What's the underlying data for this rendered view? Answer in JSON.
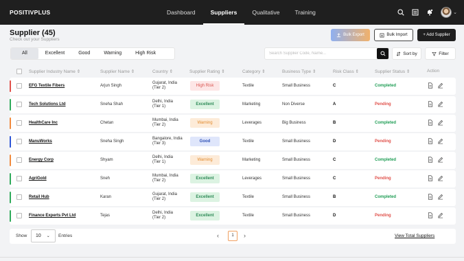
{
  "app": {
    "logo": "POSITIVPLUS",
    "nav": [
      {
        "label": "Dashboard",
        "active": false
      },
      {
        "label": "Suppliers",
        "active": true
      },
      {
        "label": "Qualitative",
        "active": false
      },
      {
        "label": "Training",
        "active": false
      }
    ],
    "icons": [
      "search-icon",
      "clipboard-icon",
      "notification-icon",
      "avatar",
      "chevron-down-icon"
    ]
  },
  "header": {
    "title": "Supplier (45)",
    "subtitle": "Check out  your Suppliers",
    "bulk_export": "Bulk Export",
    "bulk_import": "Bulk Import",
    "add_supplier": "+ Add Supplier"
  },
  "filters": {
    "tabs": [
      "All",
      "Excellent",
      "Good",
      "Warning",
      "High Risk"
    ],
    "active_tab": "All",
    "search_placeholder": "Search Supplier Code, Name...",
    "sort_label": "Sort by",
    "filter_label": "Filter"
  },
  "table": {
    "columns": [
      "Supplier Industry Name",
      "Supplier Name",
      "Country",
      "Supplier Rating",
      "Category",
      "Business Type",
      "Risk Class",
      "Supplier Status",
      "Action"
    ],
    "rows": [
      {
        "industry": "EFG Textile Fibers",
        "name": "Arjun Singh",
        "country": [
          "Gujarat, India",
          "(Tier 2)"
        ],
        "rating": "High Risk",
        "category": "Textile",
        "business": "Small Business",
        "risk": "C",
        "status": "Completed",
        "color": "#e0504a"
      },
      {
        "industry": "Tech Solutions Ltd",
        "name": "Sneha Shah",
        "country": [
          "Delhi, India",
          "(Tier 1)"
        ],
        "rating": "Excellent",
        "category": "Marketing",
        "business": "Non Diverse",
        "risk": "A",
        "status": "Pending",
        "color": "#2eaa5a"
      },
      {
        "industry": "HealthCare Inc",
        "name": "Chetan",
        "country": [
          "Mumbai, India",
          "(Tier 2)"
        ],
        "rating": "Warning",
        "category": "Leverages",
        "business": "Big Business",
        "risk": "B",
        "status": "Completed",
        "color": "#f08a3c"
      },
      {
        "industry": "ManuWorks",
        "name": "Sneha Singh",
        "country": [
          "Bangalore, India",
          "(Tier 3)"
        ],
        "rating": "Good",
        "category": "Textile",
        "business": "Small Business",
        "risk": "D",
        "status": "Pending",
        "color": "#2d56d6"
      },
      {
        "industry": "Energy Corp",
        "name": "Shyam",
        "country": [
          "Delhi, India",
          "(Tier 1)"
        ],
        "rating": "Warning",
        "category": "Marketing",
        "business": "Small Business",
        "risk": "C",
        "status": "Completed",
        "color": "#f08a3c"
      },
      {
        "industry": "AgriGold",
        "name": "Sneh",
        "country": [
          "Mumbai, India",
          "(Tier 2)"
        ],
        "rating": "Excellent",
        "category": "Leverages",
        "business": "Small Business",
        "risk": "C",
        "status": "Pending",
        "color": "#2eaa5a"
      },
      {
        "industry": "Retail Hub",
        "name": "Karan",
        "country": [
          "Gujarat, India",
          "(Tier 2)"
        ],
        "rating": "Excellent",
        "category": "Textile",
        "business": "Small Business",
        "risk": "B",
        "status": "Completed",
        "color": "#2eaa5a"
      },
      {
        "industry": "Finance Experts Pvt Ltd",
        "name": "Tejas",
        "country": [
          "Delhi, India",
          "(Tier 2)"
        ],
        "rating": "Excellent",
        "category": "Textile",
        "business": "Small Business",
        "risk": "D",
        "status": "Pending",
        "color": "#2eaa5a"
      }
    ]
  },
  "footer": {
    "show_label": "Show",
    "page_size": "10",
    "entries_label": "Entries",
    "current_page": "1",
    "view_all": "View Total Suppliers"
  },
  "colors": {
    "completed": "#1f9d55",
    "pending": "#e0504a",
    "topbar": "#1f1f1f"
  }
}
